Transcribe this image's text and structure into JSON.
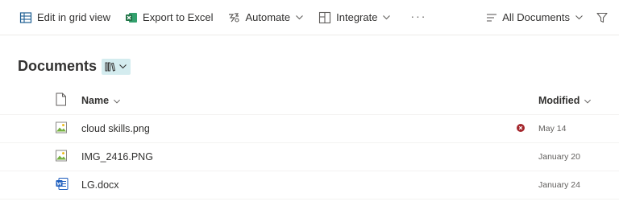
{
  "toolbar": {
    "edit_grid": "Edit in grid view",
    "export_excel": "Export to Excel",
    "automate": "Automate",
    "integrate": "Integrate",
    "more": "···",
    "view": "All Documents"
  },
  "library": {
    "title": "Documents"
  },
  "columns": {
    "name": "Name",
    "modified": "Modified"
  },
  "files": [
    {
      "name": "cloud skills.png",
      "modified": "May 14",
      "type": "image",
      "status": "sync-error"
    },
    {
      "name": "IMG_2416.PNG",
      "modified": "January 20",
      "type": "image",
      "status": ""
    },
    {
      "name": "LG.docx",
      "modified": "January 24",
      "type": "word",
      "status": ""
    }
  ],
  "colors": {
    "excel_green": "#217346",
    "word_blue": "#185abd",
    "error_red": "#a4262c",
    "view_switch_bg": "#d4ecef"
  }
}
